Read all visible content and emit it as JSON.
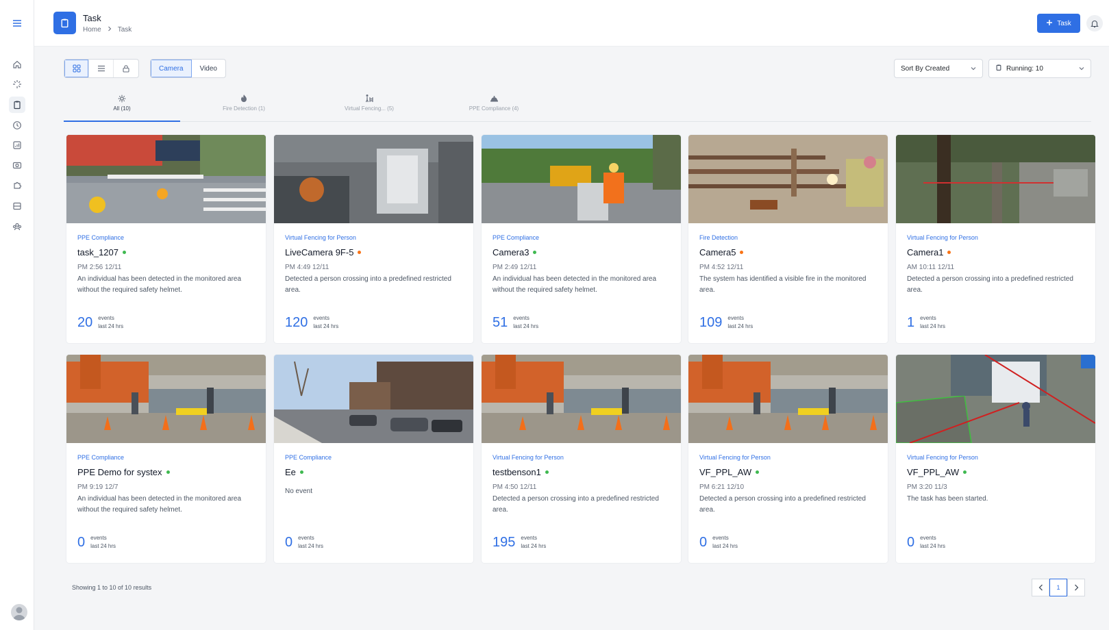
{
  "header": {
    "title": "Task",
    "breadcrumb": [
      "Home",
      "Task"
    ],
    "add_task_label": "Task",
    "add_task_icon": "plus-icon",
    "notification_icon": "bell-icon"
  },
  "sidebar": {
    "menu_icon": "hamburger-icon",
    "items": [
      {
        "name": "home-icon"
      },
      {
        "name": "spark-icon"
      },
      {
        "name": "clipboard-icon",
        "active": true
      },
      {
        "name": "clock-icon"
      },
      {
        "name": "chart-icon"
      },
      {
        "name": "camera-icon"
      },
      {
        "name": "puzzle-icon"
      },
      {
        "name": "storage-icon"
      },
      {
        "name": "users-icon"
      }
    ],
    "avatar": "user-avatar"
  },
  "toolbar": {
    "view_modes": [
      "grid-view-icon",
      "list-view-icon",
      "lock-icon"
    ],
    "source_tabs": [
      "Camera",
      "Video"
    ],
    "active_source": "Camera",
    "sort_label": "Sort By Created",
    "running_label": "Running: 10"
  },
  "category_tabs": [
    {
      "label": "All (10)",
      "icon": "sun-icon",
      "active": true
    },
    {
      "label": "Fire Detection (1)",
      "icon": "flame-icon",
      "active": false
    },
    {
      "label": "Virtual Fencing... (5)",
      "icon": "fence-person-icon",
      "active": false
    },
    {
      "label": "PPE Compliance (4)",
      "icon": "helmet-icon",
      "active": false
    }
  ],
  "cards": [
    {
      "category": "PPE Compliance",
      "name": "task_1207",
      "status": "green",
      "time": "PM 2:56 12/11",
      "desc": "An individual has been detected in the monitored area without the required safety helmet.",
      "events": "20",
      "events_label": "events",
      "period_label": "last 24 hrs",
      "scene": "street"
    },
    {
      "category": "Virtual Fencing for Person",
      "name": "LiveCamera 9F-5",
      "status": "orange",
      "time": "PM 4:49 12/11",
      "desc": "Detected a person crossing into a predefined restricted area.",
      "events": "120",
      "events_label": "events",
      "period_label": "last 24 hrs",
      "scene": "office"
    },
    {
      "category": "PPE Compliance",
      "name": "Camera3",
      "status": "green",
      "time": "PM 2:49 12/11",
      "desc": "An individual has been detected in the monitored area without the required safety helmet.",
      "events": "51",
      "events_label": "events",
      "period_label": "last 24 hrs",
      "scene": "roadwork"
    },
    {
      "category": "Fire Detection",
      "name": "Camera5",
      "status": "orange",
      "time": "PM 4:52 12/11",
      "desc": "The system has identified a visible fire in the monitored area.",
      "events": "109",
      "events_label": "events",
      "period_label": "last 24 hrs",
      "scene": "welding"
    },
    {
      "category": "Virtual Fencing for Person",
      "name": "Camera1",
      "status": "orange",
      "time": "AM 10:11 12/11",
      "desc": "Detected a person crossing into a predefined restricted area.",
      "events": "1",
      "events_label": "events",
      "period_label": "last 24 hrs",
      "scene": "park"
    },
    {
      "category": "PPE Compliance",
      "name": "PPE Demo for systex",
      "status": "green",
      "time": "PM 9:19 12/7",
      "desc": "An individual has been detected in the monitored area without the required safety helmet.",
      "events": "0",
      "events_label": "events",
      "period_label": "last 24 hrs",
      "scene": "construction"
    },
    {
      "category": "PPE Compliance",
      "name": "Ee",
      "status": "green",
      "time": "",
      "desc": "No event",
      "events": "0",
      "events_label": "events",
      "period_label": "last 24 hrs",
      "scene": "citystreet"
    },
    {
      "category": "Virtual Fencing for Person",
      "name": "testbenson1",
      "status": "green",
      "time": "PM 4:50 12/11",
      "desc": "Detected a person crossing into a predefined restricted area.",
      "events": "195",
      "events_label": "events",
      "period_label": "last 24 hrs",
      "scene": "construction"
    },
    {
      "category": "Virtual Fencing for Person",
      "name": "VF_PPL_AW",
      "status": "green",
      "time": "PM 6:21 12/10",
      "desc": "Detected a person crossing into a predefined restricted area.",
      "events": "0",
      "events_label": "events",
      "period_label": "last 24 hrs",
      "scene": "construction"
    },
    {
      "category": "Virtual Fencing for Person",
      "name": "VF_PPL_AW",
      "status": "green",
      "time": "PM 3:20 11/3",
      "desc": "The task has been started.",
      "events": "0",
      "events_label": "events",
      "period_label": "last 24 hrs",
      "scene": "truck"
    }
  ],
  "footer": {
    "results_text": "Showing 1 to 10 of 10 results",
    "current_page": "1"
  },
  "colors": {
    "accent": "#2f6fe4",
    "status_green": "#3fb950",
    "status_orange": "#f97316"
  }
}
